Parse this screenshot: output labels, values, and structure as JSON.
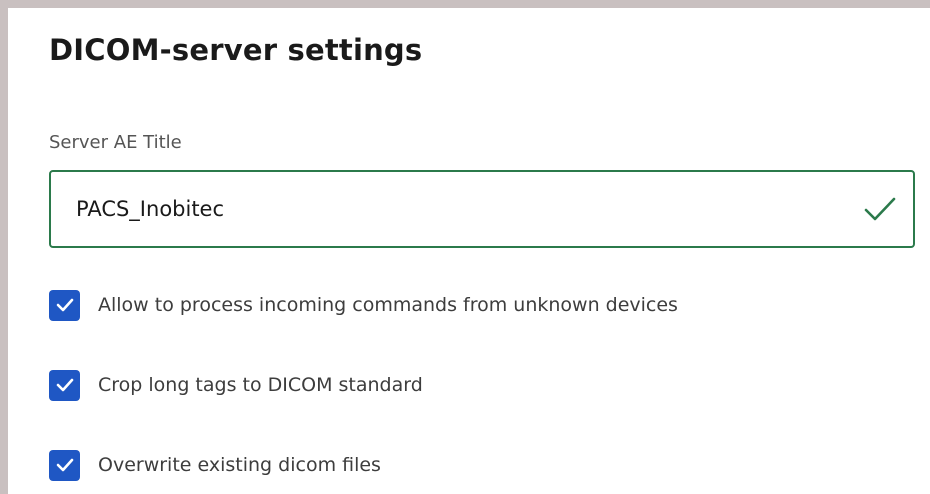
{
  "page": {
    "title": "DICOM-server settings"
  },
  "server_ae_title": {
    "label": "Server AE Title",
    "value": "PACS_Inobitec",
    "valid": true
  },
  "options": [
    {
      "label": "Allow to process incoming commands from unknown devices",
      "checked": true
    },
    {
      "label": "Crop long tags to DICOM standard",
      "checked": true
    },
    {
      "label": "Overwrite existing dicom files",
      "checked": true
    }
  ],
  "colors": {
    "accent": "#1f57c4",
    "valid_border": "#2b7a4b",
    "frame_border": "#c9c0c0"
  },
  "icons": {
    "input_status": "checkmark-icon",
    "checkbox_mark": "checkmark-icon"
  }
}
